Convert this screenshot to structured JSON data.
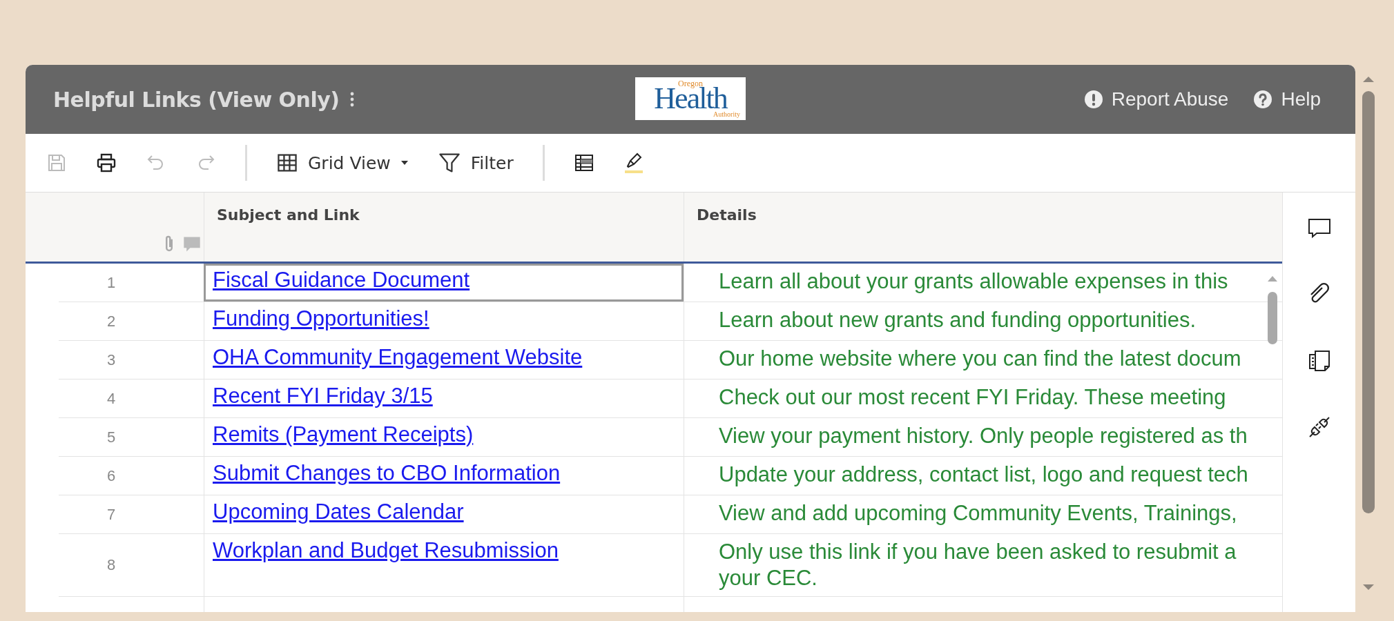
{
  "header": {
    "title": "Helpful Links (View Only)",
    "logo": {
      "top": "Oregon",
      "main": "Health",
      "bottom": "Authority"
    },
    "actions": [
      {
        "kind": "alert",
        "label": "Report Abuse"
      },
      {
        "kind": "help",
        "label": "Help"
      }
    ]
  },
  "toolbar": [
    {
      "kind": "save",
      "disabled": true
    },
    {
      "kind": "print",
      "disabled": false
    },
    {
      "kind": "undo",
      "disabled": true
    },
    {
      "kind": "redo",
      "disabled": true
    },
    {
      "kind": "divider"
    },
    {
      "kind": "view",
      "label": "Grid View",
      "disabled": false
    },
    {
      "kind": "filter",
      "label": "Filter",
      "disabled": false
    },
    {
      "kind": "divider"
    },
    {
      "kind": "table",
      "disabled": false
    },
    {
      "kind": "highlight",
      "disabled": false
    }
  ],
  "table": {
    "columns": [
      "Subject and Link",
      "Details"
    ],
    "rows": [
      {
        "number": "1",
        "subject": "Fiscal Guidance Document",
        "details": [
          "Learn all about your grants allowable expenses in this"
        ],
        "selected": true
      },
      {
        "number": "2",
        "subject": "Funding Opportunities!",
        "details": [
          "Learn about new grants and funding opportunities."
        ],
        "selected": false
      },
      {
        "number": "3",
        "subject": "OHA Community Engagement Website",
        "details": [
          "Our home website where you can find the latest docum"
        ],
        "selected": false
      },
      {
        "number": "4",
        "subject": "Recent FYI Friday 3/15",
        "details": [
          "Check out our most recent FYI Friday. These meeting"
        ],
        "selected": false
      },
      {
        "number": "5",
        "subject": "Remits (Payment Receipts)",
        "details": [
          "View your payment history. Only people registered as th"
        ],
        "selected": false
      },
      {
        "number": "6",
        "subject": "Submit Changes to CBO Information",
        "details": [
          "Update your address, contact list, logo and request tech"
        ],
        "selected": false
      },
      {
        "number": "7",
        "subject": "Upcoming Dates Calendar",
        "details": [
          "View and add upcoming Community Events, Trainings,"
        ],
        "selected": false
      },
      {
        "number": "8",
        "subject": "Workplan and Budget Resubmission",
        "details": [
          "Only use this link if you have been asked to resubmit a",
          "your CEC."
        ],
        "selected": false
      }
    ]
  },
  "side_panel": [
    {
      "kind": "comment"
    },
    {
      "kind": "attachment"
    },
    {
      "kind": "document"
    },
    {
      "kind": "plug"
    }
  ]
}
